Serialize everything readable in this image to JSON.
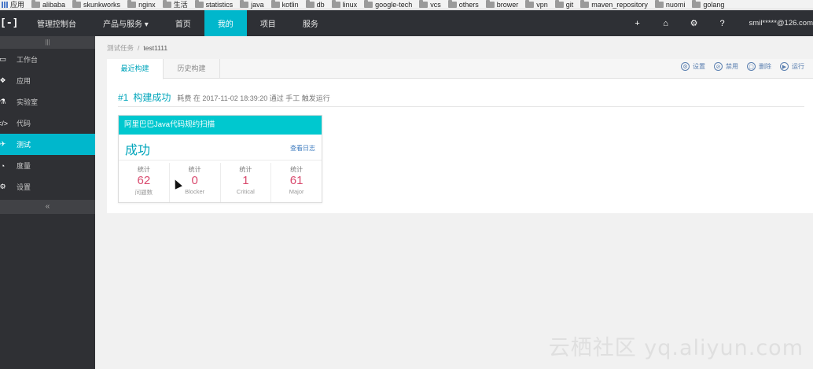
{
  "bookmarks": [
    {
      "label": "应用",
      "folder": false
    },
    {
      "label": "alibaba",
      "folder": true
    },
    {
      "label": "skunkworks",
      "folder": true
    },
    {
      "label": "nginx",
      "folder": true
    },
    {
      "label": "生活",
      "folder": true
    },
    {
      "label": "statistics",
      "folder": true
    },
    {
      "label": "java",
      "folder": true
    },
    {
      "label": "kotlin",
      "folder": true
    },
    {
      "label": "db",
      "folder": true
    },
    {
      "label": "linux",
      "folder": true
    },
    {
      "label": "google-tech",
      "folder": true
    },
    {
      "label": "vcs",
      "folder": true
    },
    {
      "label": "others",
      "folder": true
    },
    {
      "label": "brower",
      "folder": true
    },
    {
      "label": "vpn",
      "folder": true
    },
    {
      "label": "git",
      "folder": true
    },
    {
      "label": "maven_repository",
      "folder": true
    },
    {
      "label": "nuomi",
      "folder": true
    },
    {
      "label": "golang",
      "folder": true
    }
  ],
  "topnav": {
    "logo": "[-]",
    "items": [
      "管理控制台",
      "产品与服务 ▾",
      "首页",
      "我的",
      "项目",
      "服务"
    ],
    "active_index": 3,
    "icons": [
      "+",
      "⌂",
      "⚙",
      "?"
    ],
    "user": "smil*****@126.com"
  },
  "sidebar": {
    "handle": "|||",
    "items": [
      {
        "label": "工作台",
        "icon": "monitor-icon",
        "glyph": "▭"
      },
      {
        "label": "应用",
        "icon": "apps-icon",
        "glyph": "❖"
      },
      {
        "label": "实验室",
        "icon": "flask-icon",
        "glyph": "⚗"
      },
      {
        "label": "代码",
        "icon": "code-icon",
        "glyph": "</>"
      },
      {
        "label": "测试",
        "icon": "rocket-icon",
        "glyph": "✈"
      },
      {
        "label": "度量",
        "icon": "gauge-icon",
        "glyph": "◔"
      },
      {
        "label": "设置",
        "icon": "gear-icon",
        "glyph": "⚙"
      }
    ],
    "active_index": 4,
    "collapse": "«"
  },
  "breadcrumb": {
    "parent": "测试任务",
    "separator": "/",
    "current": "test1111"
  },
  "tabs": [
    "最近构建",
    "历史构建"
  ],
  "actions": [
    {
      "label": "设置",
      "icon": "settings-icon",
      "glyph": "⚙"
    },
    {
      "label": "禁用",
      "icon": "lock-icon",
      "glyph": "⊘"
    },
    {
      "label": "删除",
      "icon": "trash-icon",
      "glyph": "▢"
    },
    {
      "label": "运行",
      "icon": "play-icon",
      "glyph": "▶"
    }
  ],
  "build": {
    "number": "#1",
    "status_title": "构建成功",
    "meta": "耗费 在 2017-11-02 18:39:20 通过 手工 触发运行"
  },
  "card": {
    "title": "阿里巴巴Java代码规约扫描",
    "status": "成功",
    "log_link": "查看日志",
    "stats": [
      {
        "label": "统计",
        "value": "62",
        "sub": "问题数"
      },
      {
        "label": "统计",
        "value": "0",
        "sub": "Blocker"
      },
      {
        "label": "统计",
        "value": "1",
        "sub": "Critical"
      },
      {
        "label": "统计",
        "value": "61",
        "sub": "Major"
      }
    ]
  },
  "watermark": "云栖社区 yq.aliyun.com",
  "colors": {
    "accent": "#00b7cc",
    "nav_bg": "#2e3035",
    "stat_value": "#d94a6e",
    "card_head": "#00c8cf"
  }
}
